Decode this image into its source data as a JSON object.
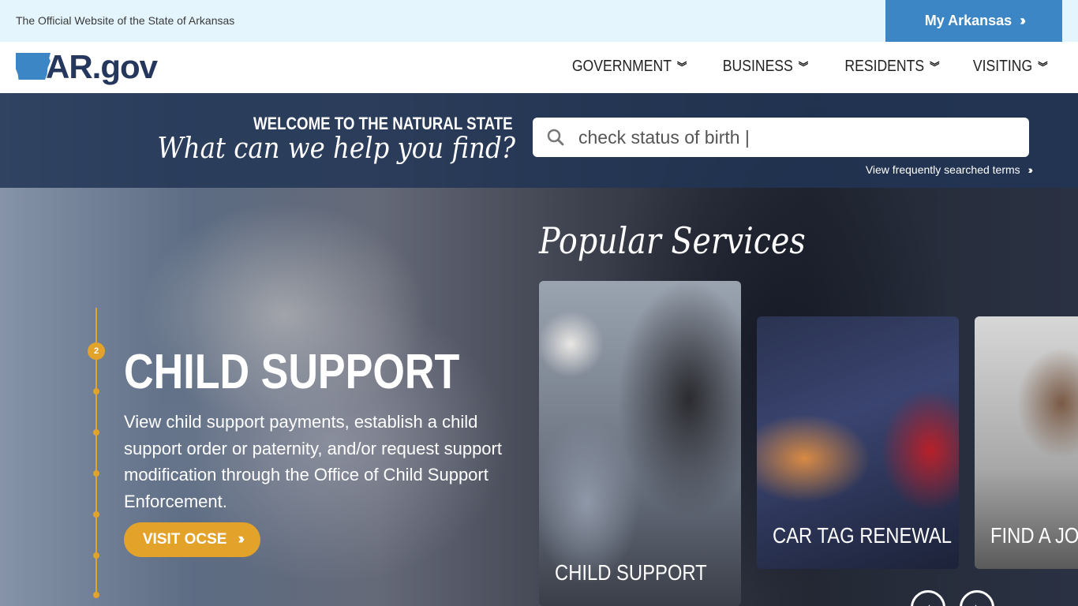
{
  "topbar": {
    "official_text": "The Official Website of the State of Arkansas",
    "my_arkansas_label": "My Arkansas"
  },
  "nav": {
    "logo_text": "AR.gov",
    "items": [
      {
        "label": "GOVERNMENT"
      },
      {
        "label": "BUSINESS"
      },
      {
        "label": "RESIDENTS"
      },
      {
        "label": "VISITING"
      }
    ]
  },
  "search": {
    "welcome": "WELCOME TO THE NATURAL STATE",
    "prompt": "What can we help you find?",
    "value": "check status of birth |",
    "frequent_link": "View frequently searched terms"
  },
  "slider": {
    "active_number": "2",
    "title": "CHILD SUPPORT",
    "description": "View child support payments, establish a child support order or paternity, and/or request support modification through the Office of Child Support Enforcement.",
    "button_label": "VISIT OCSE"
  },
  "popular": {
    "heading": "Popular Services",
    "cards": [
      {
        "label": "CHILD SUPPORT"
      },
      {
        "label": "CAR TAG RENEWAL"
      },
      {
        "label": "FIND A JOB"
      }
    ]
  },
  "colors": {
    "accent_blue": "#3d86c6",
    "navy": "#25375c",
    "gold": "#e3a32a",
    "topbar_bg": "#e4f5fd"
  },
  "icons": [
    "double-chevron-right-icon",
    "double-chevron-down-icon",
    "search-icon",
    "arkansas-state-icon",
    "chevron-left-icon",
    "chevron-right-icon"
  ]
}
